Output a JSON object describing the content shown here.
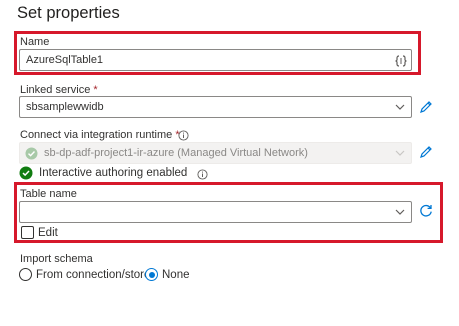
{
  "panel": {
    "title": "Set properties"
  },
  "name_field": {
    "label": "Name",
    "value": "AzureSqlTable1",
    "icon": "variable-braces-icon"
  },
  "linked_service": {
    "label": "Linked service",
    "required_mark": "*",
    "value": "sbsamplewwidb",
    "edit_icon": "pencil-icon"
  },
  "runtime": {
    "label": "Connect via integration runtime",
    "required_mark": "*",
    "info_icon": "info-icon",
    "value": "sb-dp-adf-project1-ir-azure (Managed Virtual Network)",
    "status_text": "Interactive authoring enabled",
    "status_icon": "success-check-icon"
  },
  "table_name": {
    "label": "Table name",
    "value": "",
    "refresh_icon": "refresh-icon",
    "edit_label": "Edit",
    "edit_checked": false
  },
  "import_schema": {
    "label": "Import schema",
    "options": [
      {
        "label": "From connection/store",
        "selected": false
      },
      {
        "label": "None",
        "selected": true
      }
    ]
  },
  "colors": {
    "highlight": "#d6182b",
    "accent": "#0078d4",
    "success": "#107c10"
  }
}
